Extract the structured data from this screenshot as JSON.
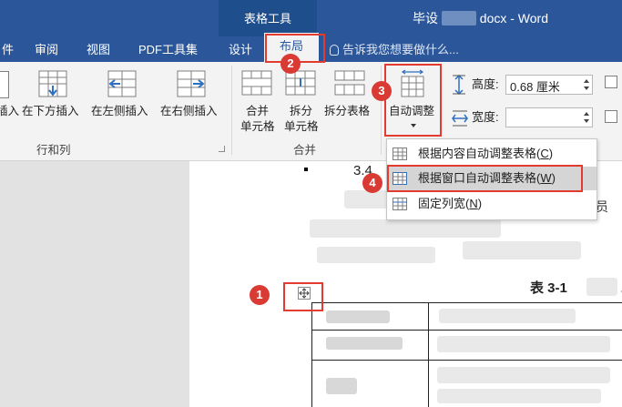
{
  "titlebar": {
    "context_group": "表格工具",
    "doc_title_prefix": "毕设",
    "doc_title_suffix": "docx - Word"
  },
  "tabs": [
    "件",
    "审阅",
    "视图",
    "PDF工具集",
    "设计"
  ],
  "active_tab": "布局",
  "search_hint": "告诉我您想要做什么...",
  "ribbon": {
    "insert_left_partial": "插入",
    "insert_below": "在下方插入",
    "insert_left": "在左侧插入",
    "insert_right": "在右侧插入",
    "group_rows_cols": "行和列",
    "merge_cells_line1": "合并",
    "merge_cells_line2": "单元格",
    "split_cells_line1": "拆分",
    "split_cells_line2": "单元格",
    "split_table": "拆分表格",
    "group_merge": "合并",
    "autofit": "自动调整",
    "height_label": "高度:",
    "height_value": "0.68 厘米",
    "width_label": "宽度:",
    "width_value": ""
  },
  "menu": {
    "items": [
      {
        "label": "根据内容自动调整表格(C)",
        "underline_key": "C"
      },
      {
        "label": "根据窗口自动调整表格(W)",
        "underline_key": "W"
      },
      {
        "label": "固定列宽(N)",
        "underline_key": "N"
      }
    ]
  },
  "document": {
    "heading_partial": "3.4",
    "table_caption": "表 3-1",
    "char_a": "员",
    "char_b": "a"
  },
  "annotations": [
    "1",
    "2",
    "3",
    "4"
  ],
  "colors": {
    "title_blue": "#2b579a",
    "annotation_red": "#e23b30"
  }
}
